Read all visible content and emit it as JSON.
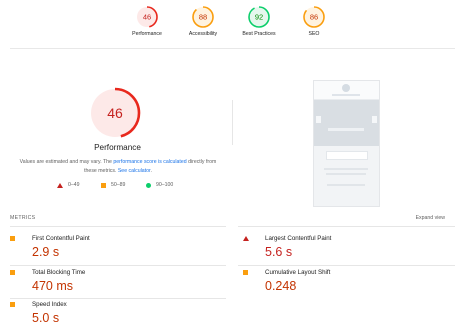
{
  "scores": [
    {
      "label": "Performance",
      "value": "46",
      "score": 46,
      "level": "poor"
    },
    {
      "label": "Accessibility",
      "value": "88",
      "score": 88,
      "level": "average"
    },
    {
      "label": "Best Practices",
      "value": "92",
      "score": 92,
      "level": "good"
    },
    {
      "label": "SEO",
      "value": "86",
      "score": 86,
      "level": "average"
    }
  ],
  "performance": {
    "score_text": "46",
    "score": 46,
    "title": "Performance",
    "desc_prefix": "Values are estimated and may vary. The ",
    "desc_link1": "performance score is calculated",
    "desc_mid": " directly from these metrics. ",
    "desc_link2": "See calculator",
    "desc_suffix": "."
  },
  "legend": [
    {
      "range": "0–49",
      "shape": "triangle"
    },
    {
      "range": "50–89",
      "shape": "square"
    },
    {
      "range": "90–100",
      "shape": "circle"
    }
  ],
  "metrics_section": {
    "heading": "METRICS",
    "expand_label": "Expand view"
  },
  "metrics": [
    {
      "name": "First Contentful Paint",
      "value": "2.9 s",
      "level": "average"
    },
    {
      "name": "Largest Contentful Paint",
      "value": "5.6 s",
      "level": "poor"
    },
    {
      "name": "Total Blocking Time",
      "value": "470 ms",
      "level": "average"
    },
    {
      "name": "Cumulative Layout Shift",
      "value": "0.248",
      "level": "average"
    },
    {
      "name": "Speed Index",
      "value": "5.0 s",
      "level": "average"
    }
  ],
  "colors": {
    "poor": "#e8281d",
    "poor_text": "#c5221f",
    "poor_bg": "#fde9e8",
    "average": "#fa9e0f",
    "average_text": "#c33300",
    "average_bg": "#fff3e0",
    "good": "#0cce6b",
    "good_text": "#008800",
    "good_bg": "#e6f7ed",
    "link": "#1a73e8"
  }
}
